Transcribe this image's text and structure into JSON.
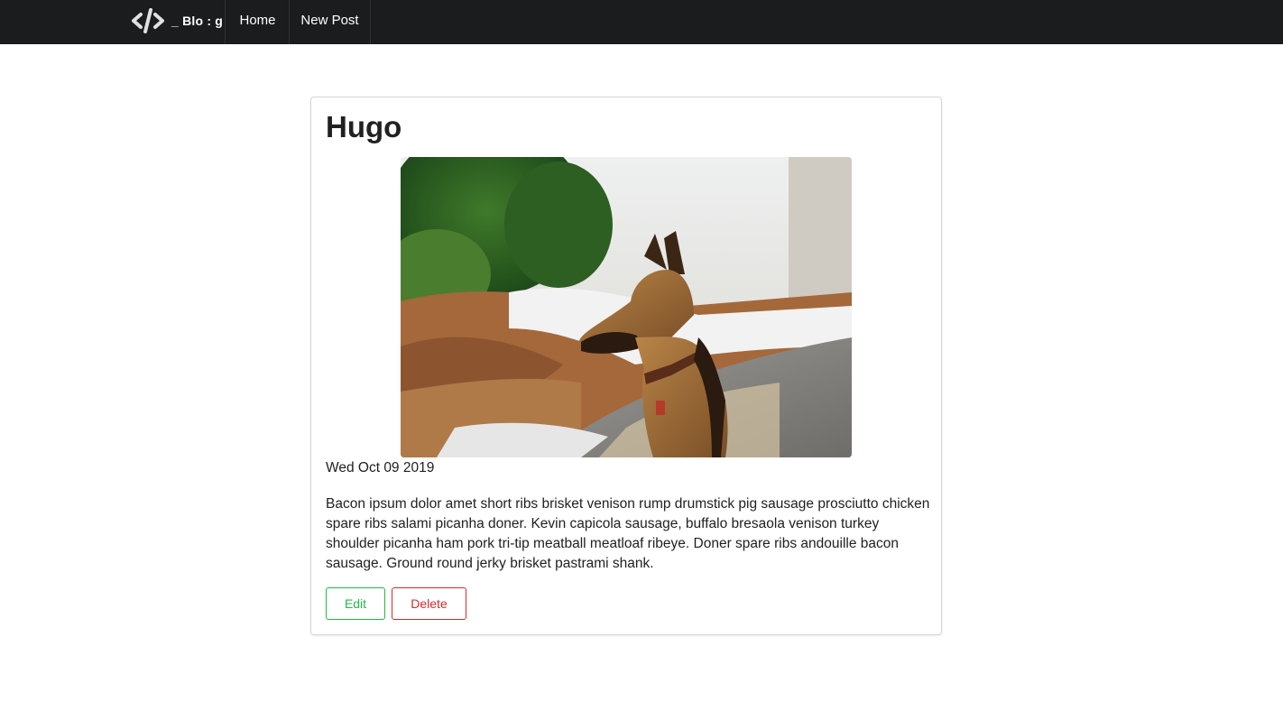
{
  "brand": {
    "text": "_ Blo : g",
    "icon": "code-icon"
  },
  "nav": {
    "home_label": "Home",
    "new_post_label": "New Post"
  },
  "post": {
    "title": "Hugo",
    "image_subject": "german-shepherd-dog-photo",
    "date": "Wed Oct 09 2019",
    "body": "Bacon ipsum dolor amet short ribs brisket venison rump drumstick pig sausage prosciutto chicken spare ribs salami picanha doner. Kevin capicola sausage, buffalo bresaola venison turkey shoulder picanha ham pork tri-tip meatball meatloaf ribeye. Doner spare ribs andouille bacon sausage. Ground round jerky brisket pastrami shank.",
    "edit_label": "Edit",
    "delete_label": "Delete"
  },
  "colors": {
    "navbar": "#1b1c1d",
    "edit": "#21ba45",
    "delete": "#db2828"
  }
}
